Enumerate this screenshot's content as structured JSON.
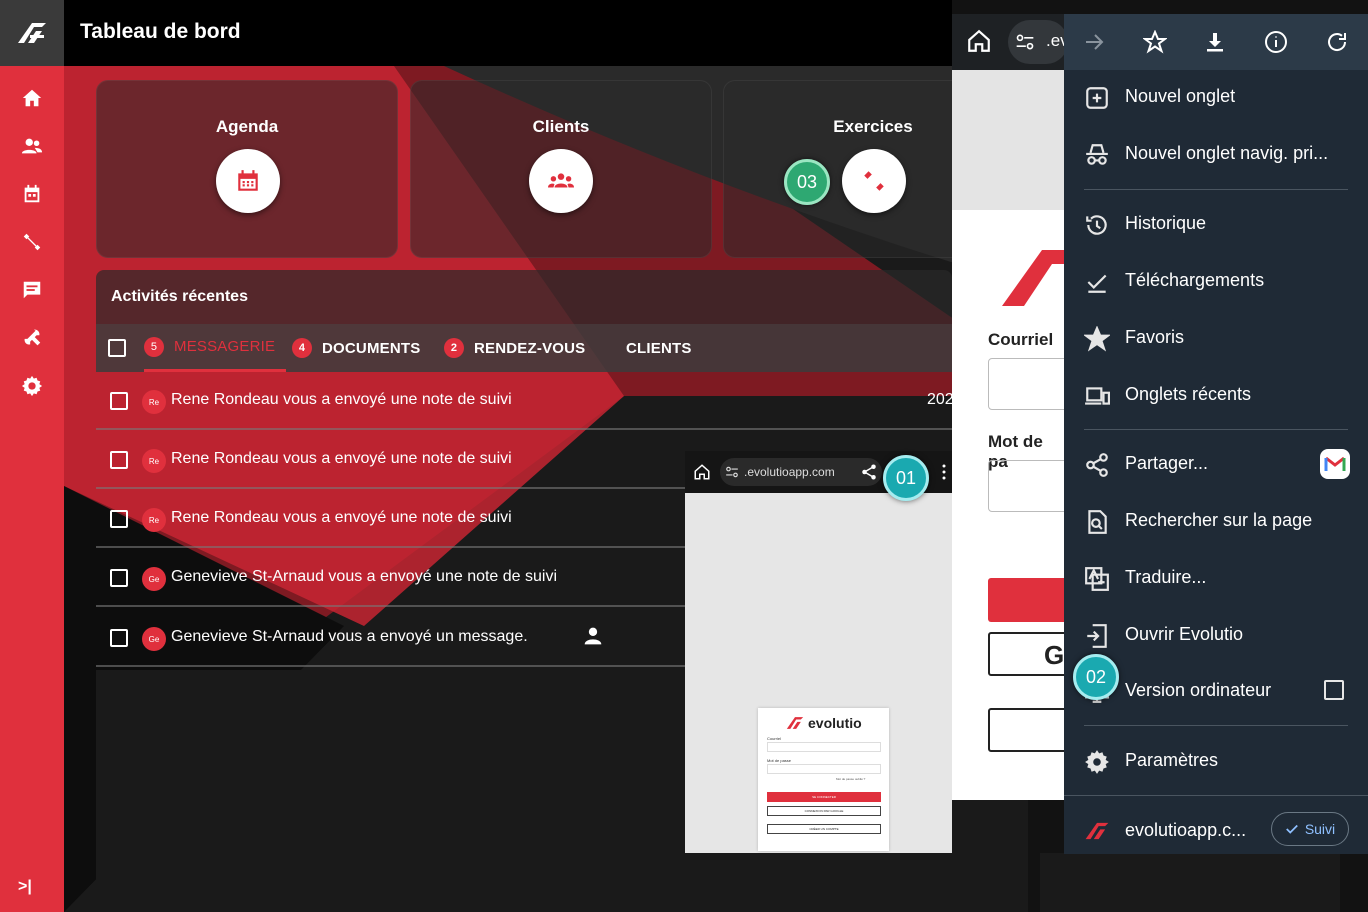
{
  "header": {
    "title": "Tableau de bord"
  },
  "sidebar": {
    "items": [
      {
        "icon": "home-icon"
      },
      {
        "icon": "clients-icon"
      },
      {
        "icon": "calendar-icon"
      },
      {
        "icon": "exercise-icon"
      },
      {
        "icon": "message-icon"
      },
      {
        "icon": "tools-icon"
      },
      {
        "icon": "settings-icon"
      }
    ],
    "collapse_label": ">|"
  },
  "cards": [
    {
      "label": "Agenda",
      "icon": "calendar-icon"
    },
    {
      "label": "Clients",
      "icon": "clients-icon"
    },
    {
      "label": "Exercices",
      "icon": "dumbbell-icon"
    }
  ],
  "activity": {
    "title": "Activités récentes",
    "tabs": [
      {
        "badge": "5",
        "label": "MESSAGERIE"
      },
      {
        "badge": "4",
        "label": "DOCUMENTS"
      },
      {
        "badge": "2",
        "label": "RENDEZ-VOUS"
      },
      {
        "badge": "",
        "label": "CLIENTS"
      }
    ],
    "rows": [
      {
        "avatar": "Re",
        "text": "Rene Rondeau vous a envoyé une note de suivi",
        "date": "202"
      },
      {
        "avatar": "Re",
        "text": "Rene Rondeau vous a envoyé une note de suivi",
        "date": ""
      },
      {
        "avatar": "Re",
        "text": "Rene Rondeau vous a envoyé une note de suivi",
        "date": ""
      },
      {
        "avatar": "Ge",
        "text": "Genevieve St-Arnaud vous a envoyé une note de suivi",
        "date": ""
      },
      {
        "avatar": "Ge",
        "text": "Genevieve St-Arnaud vous a envoyé un message.",
        "date": ""
      }
    ]
  },
  "phone": {
    "url": ".evolutioapp.com",
    "mini": {
      "brand": "evolutio",
      "email_label": "Courriel",
      "password_label": "Mot de passe",
      "forgot": "Mot de passe oublié ?",
      "login": "SE CONNECTER",
      "google": "CONNEXION PAR GOOGLE",
      "create": "CRÉER UN COMPTE"
    }
  },
  "browser": {
    "url_fragment": ".ev",
    "email_label": "Courriel",
    "password_label": "Mot de pa",
    "google_letter": "G"
  },
  "menu": {
    "items": [
      {
        "label": "Nouvel onglet",
        "icon": "new-tab-icon"
      },
      {
        "label": "Nouvel onglet navig. pri...",
        "icon": "incognito-icon"
      },
      {
        "label": "Historique",
        "icon": "history-icon"
      },
      {
        "label": "Téléchargements",
        "icon": "downloads-icon"
      },
      {
        "label": "Favoris",
        "icon": "star-icon"
      },
      {
        "label": "Onglets récents",
        "icon": "devices-icon"
      },
      {
        "label": "Partager...",
        "icon": "share-icon"
      },
      {
        "label": "Rechercher sur la page",
        "icon": "find-icon"
      },
      {
        "label": "Traduire...",
        "icon": "translate-icon"
      },
      {
        "label": "Ouvrir Evolutio",
        "icon": "open-app-icon"
      },
      {
        "label": "Version ordinateur",
        "icon": "desktop-icon"
      },
      {
        "label": "Paramètres",
        "icon": "settings-icon"
      }
    ],
    "footer": {
      "site": "evolutioapp.c...",
      "follow": "Suivi"
    }
  },
  "markers": [
    "01",
    "02",
    "03"
  ],
  "colors": {
    "accent": "#e0303d",
    "menu_bg": "#1f2a36",
    "marker": "#1aa9b0"
  }
}
